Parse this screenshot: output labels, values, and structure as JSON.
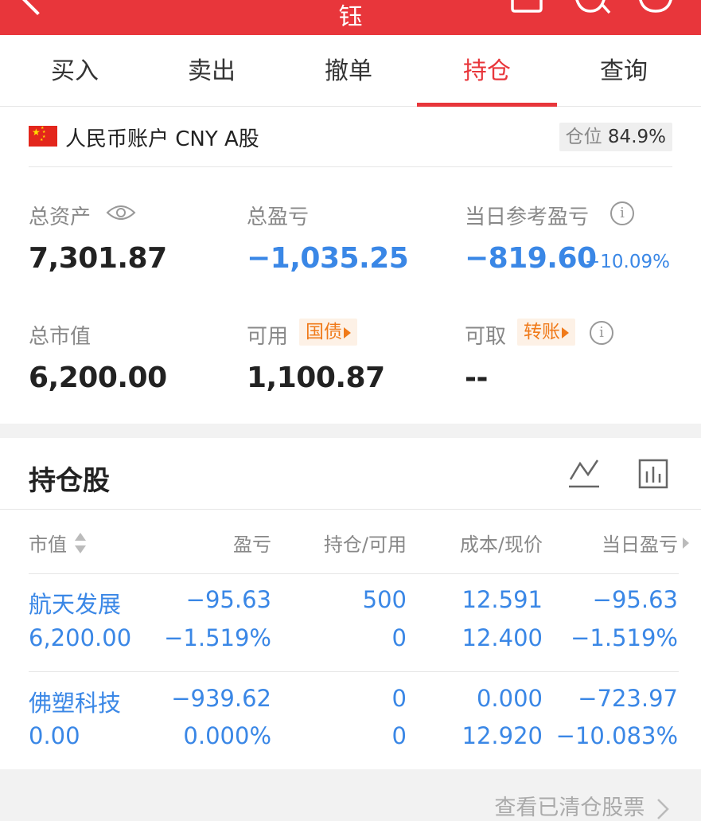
{
  "header": {
    "title": "钰"
  },
  "tabs": [
    "买入",
    "卖出",
    "撤单",
    "持仓",
    "查询"
  ],
  "active_tab_index": 3,
  "account": {
    "name": "人民币账户 CNY A股",
    "position_label": "仓位",
    "position_value": "84.9%"
  },
  "stats": {
    "total_assets_label": "总资产",
    "total_assets_value": "7,301.87",
    "total_pl_label": "总盈亏",
    "total_pl_value": "−1,035.25",
    "daily_pl_label": "当日参考盈亏",
    "daily_pl_value": "−819.60",
    "daily_pl_pct": "−10.09%",
    "market_value_label": "总市值",
    "market_value_value": "6,200.00",
    "available_label": "可用",
    "available_tag": "国债",
    "available_value": "1,100.87",
    "withdrawable_label": "可取",
    "withdrawable_tag": "转账",
    "withdrawable_value": "--"
  },
  "holdings": {
    "title": "持仓股",
    "columns": [
      "市值",
      "盈亏",
      "持仓/可用",
      "成本/现价",
      "当日盈亏"
    ],
    "rows": [
      {
        "name": "航天发展",
        "market_value": "6,200.00",
        "pl": "−95.63",
        "pl_pct": "−1.519%",
        "hold": "500",
        "avail": "0",
        "cost": "12.591",
        "price": "12.400",
        "daily_pl": "−95.63",
        "daily_pct": "−1.519%"
      },
      {
        "name": "佛塑科技",
        "market_value": "0.00",
        "pl": "−939.62",
        "pl_pct": "0.000%",
        "hold": "0",
        "avail": "0",
        "cost": "0.000",
        "price": "12.920",
        "daily_pl": "−723.97",
        "daily_pct": "−10.083%"
      }
    ]
  },
  "footer": {
    "cleared_link": "查看已清仓股票"
  },
  "colors": {
    "brand_red": "#e8363b",
    "loss_blue": "#3a87e6",
    "tag_orange": "#f07a1a"
  },
  "icons": [
    "back-arrow-icon",
    "share-icon",
    "search-icon",
    "more-icon",
    "eye-icon",
    "info-icon",
    "line-chart-icon",
    "bar-chart-icon",
    "sort-icon",
    "chevron-right-icon"
  ]
}
